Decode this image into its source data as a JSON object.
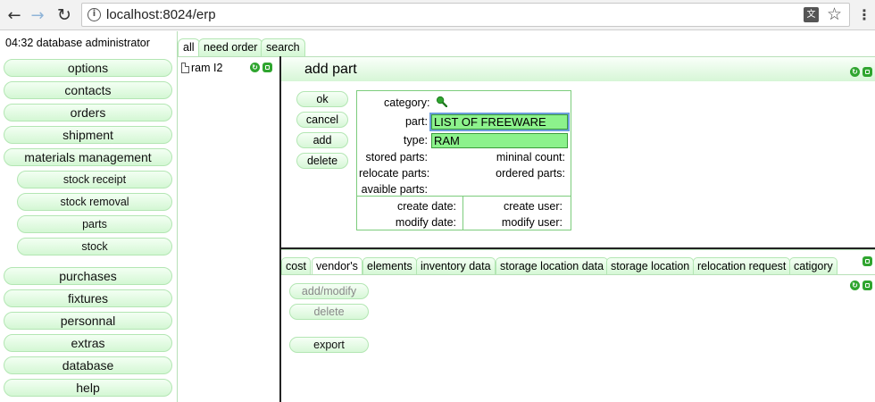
{
  "browser": {
    "url": "localhost:8024/erp",
    "back_glyph": "←",
    "forward_glyph": "→",
    "reload_glyph": "↻",
    "info_glyph": "i",
    "translate_glyph": "文",
    "star_glyph": "☆",
    "menu_glyph": "⋮"
  },
  "sidebar": {
    "user_line": "04:32 database administrator",
    "items": [
      {
        "label": "options"
      },
      {
        "label": "contacts"
      },
      {
        "label": "orders"
      },
      {
        "label": "shipment"
      },
      {
        "label": "materials management"
      },
      {
        "label": "stock receipt"
      },
      {
        "label": "stock removal"
      },
      {
        "label": "parts"
      },
      {
        "label": "stock"
      },
      {
        "label": "purchases"
      },
      {
        "label": "fixtures"
      },
      {
        "label": "personnal"
      },
      {
        "label": "extras"
      },
      {
        "label": "database"
      },
      {
        "label": "help"
      }
    ]
  },
  "top_tabs": [
    {
      "label": "all"
    },
    {
      "label": "need order"
    },
    {
      "label": "search"
    }
  ],
  "tree": {
    "item": "ram I2"
  },
  "main": {
    "title": "add part",
    "actions": {
      "ok": "ok",
      "cancel": "cancel",
      "add": "add",
      "delete": "delete"
    },
    "form": {
      "category_label": "category:",
      "part_label": "part:",
      "part_value": "LIST OF FREEWARE",
      "type_label": "type:",
      "type_value": "RAM",
      "stored_parts_label": "stored parts:",
      "minimal_count_label": "mininal count:",
      "relocate_parts_label": "relocate parts:",
      "ordered_parts_label": "ordered parts:",
      "available_parts_label": "avaible parts:",
      "create_date_label": "create date:",
      "create_user_label": "create user:",
      "modify_date_label": "modify date:",
      "modify_user_label": "modify user:"
    }
  },
  "bottom_tabs": [
    {
      "label": "cost"
    },
    {
      "label": "vendor's"
    },
    {
      "label": "elements"
    },
    {
      "label": "inventory data"
    },
    {
      "label": "storage location data"
    },
    {
      "label": "storage location"
    },
    {
      "label": "relocation request"
    },
    {
      "label": "catigory"
    }
  ],
  "bottom": {
    "add_modify": "add/modify",
    "delete": "delete",
    "export": "export"
  },
  "colors": {
    "accent": "#d4f7d4",
    "input_bg": "#8cf28c",
    "icon_green": "#2fa52f"
  }
}
